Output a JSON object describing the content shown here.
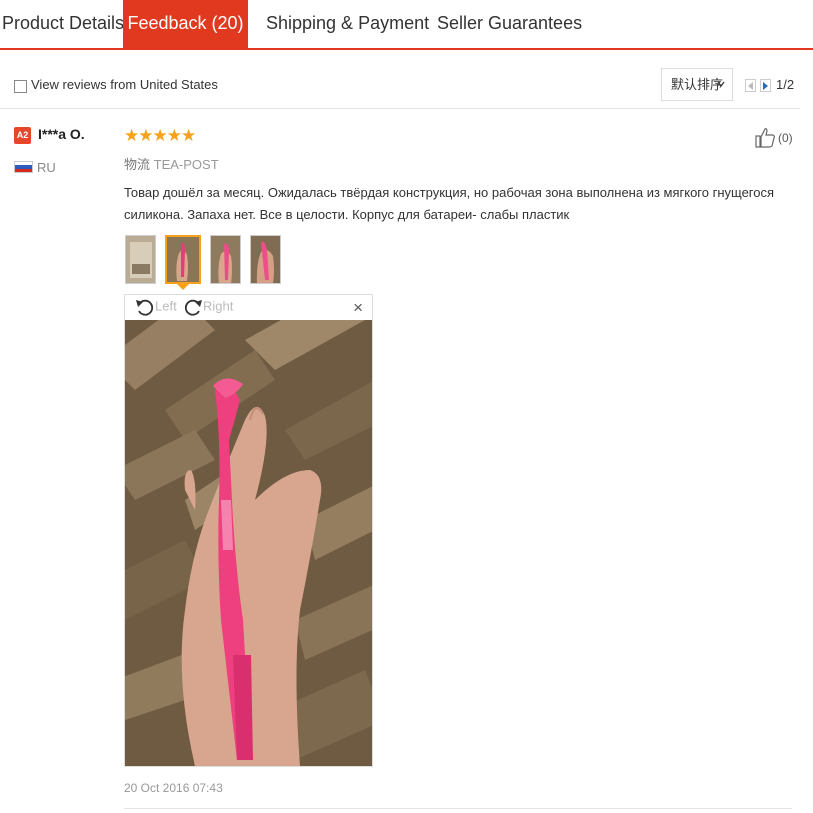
{
  "tabs": [
    {
      "label": "Product Details",
      "active": false
    },
    {
      "label": "Feedback (20)",
      "active": true
    },
    {
      "label": "Shipping & Payment",
      "active": false
    },
    {
      "label": "Seller Guarantees",
      "active": false
    }
  ],
  "filter": {
    "checkbox_label": "View reviews from United States",
    "checked": false,
    "sort_label": "默认排序",
    "pagination": "1/2"
  },
  "review": {
    "level_badge": "A2",
    "user": "I***a O.",
    "country": "RU",
    "rating": 5,
    "stars": "★★★★★",
    "shipping_label": "物流",
    "shipping_value": "TEA-POST",
    "text": "Товар дошёл за месяц. Ожидалась твёрдая конструкция, но рабочая зона выполнена из мягкого гнущегося силикона. Запаха нет. Все в целости. Корпус для батареи- слабы пластик",
    "helpful_count": "(0)",
    "date": "20 Oct 2016 07:43"
  },
  "viewer": {
    "rotate_left_label": "Left",
    "rotate_right_label": "Right",
    "close_glyph": "×"
  },
  "colors": {
    "accent": "#e0391f",
    "star": "#f7a21a",
    "badge": "#e8462b"
  }
}
